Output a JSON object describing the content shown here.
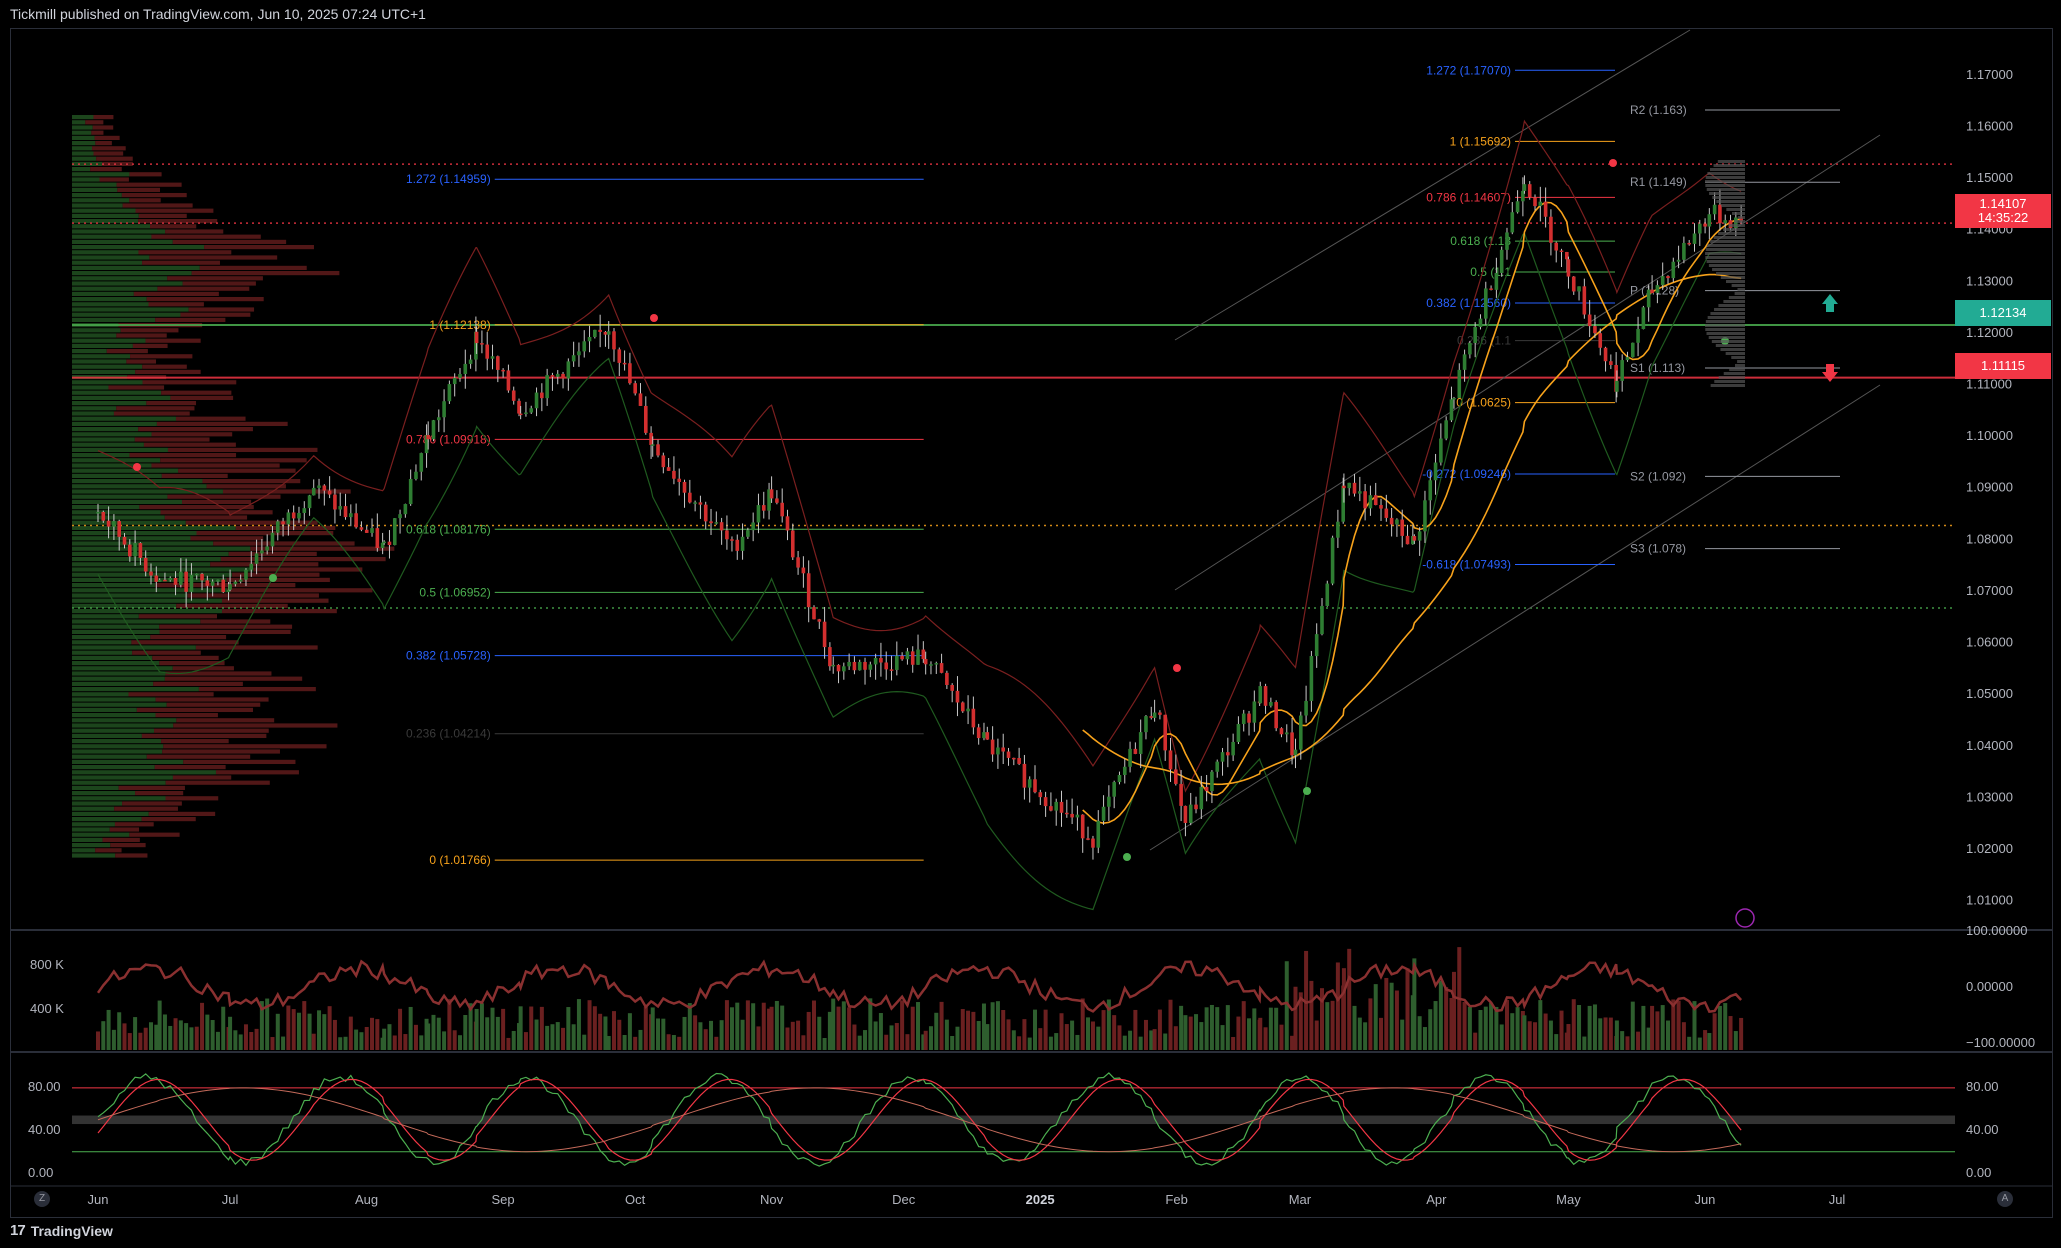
{
  "header": {
    "publisher": "Tickmill published on TradingView.com, Jun 10, 2025 07:24 UTC+1"
  },
  "footer": {
    "brand": "TradingView"
  },
  "badges": {
    "last_price": "1.14107",
    "countdown": "14:35:22",
    "green_level": "1.12134",
    "red_level": "1.11115"
  },
  "colors": {
    "up": "#22ab94",
    "candle_up": "#2e7d32",
    "candle_down": "#d32f2f",
    "red_line": "#f23645",
    "green_line": "#4caf50",
    "ma": "#f7a21b",
    "fib_blue": "#2962ff",
    "background": "#000000"
  },
  "chart_data": [
    {
      "type": "candlestick",
      "symbol_pair_unlabeled": true,
      "y_axis": {
        "ticks": [
          "1.17000",
          "1.16000",
          "1.15000",
          "1.14000",
          "1.13000",
          "1.12000",
          "1.11000",
          "1.10000",
          "1.09000",
          "1.08000",
          "1.07000",
          "1.06000",
          "1.05000",
          "1.04000",
          "1.03000",
          "1.02000",
          "1.01000"
        ],
        "range": [
          1.0045,
          1.1785
        ]
      },
      "x_axis": {
        "ticks": [
          "Jun",
          "Jul",
          "Aug",
          "Sep",
          "Oct",
          "Nov",
          "Dec",
          "2025",
          "Feb",
          "Mar",
          "Apr",
          "May",
          "Jun",
          "Jul"
        ]
      },
      "price_path": [
        [
          "2024-06-01",
          1.085
        ],
        [
          "2024-06-15",
          1.072
        ],
        [
          "2024-07-01",
          1.071
        ],
        [
          "2024-07-20",
          1.09
        ],
        [
          "2024-08-05",
          1.078
        ],
        [
          "2024-08-15",
          1.1
        ],
        [
          "2024-08-26",
          1.119
        ],
        [
          "2024-09-05",
          1.105
        ],
        [
          "2024-09-25",
          1.121
        ],
        [
          "2024-10-05",
          1.098
        ],
        [
          "2024-10-23",
          1.078
        ],
        [
          "2024-11-01",
          1.089
        ],
        [
          "2024-11-15",
          1.055
        ],
        [
          "2024-12-06",
          1.057
        ],
        [
          "2024-12-20",
          1.04
        ],
        [
          "2025-01-13",
          1.022
        ],
        [
          "2025-01-27",
          1.048
        ],
        [
          "2025-02-03",
          1.025
        ],
        [
          "2025-02-20",
          1.05
        ],
        [
          "2025-02-28",
          1.038
        ],
        [
          "2025-03-11",
          1.091
        ],
        [
          "2025-03-27",
          1.079
        ],
        [
          "2025-04-05",
          1.108
        ],
        [
          "2025-04-21",
          1.15
        ],
        [
          "2025-05-01",
          1.132
        ],
        [
          "2025-05-12",
          1.11
        ],
        [
          "2025-05-20",
          1.128
        ],
        [
          "2025-06-02",
          1.143
        ],
        [
          "2025-06-10",
          1.141
        ]
      ],
      "fib_left": [
        {
          "label": "1.272 (1.14959)",
          "value": 1.14959,
          "color": "#2962ff"
        },
        {
          "label": "1 (1.12138)",
          "value": 1.12138,
          "color": "#f7a21b"
        },
        {
          "label": "0.786 (1.09918)",
          "value": 1.09918,
          "color": "#f23645"
        },
        {
          "label": "0.618 (1.08176)",
          "value": 1.08176,
          "color": "#4caf50"
        },
        {
          "label": "0.5 (1.06952)",
          "value": 1.06952,
          "color": "#4caf50"
        },
        {
          "label": "0.382 (1.05728)",
          "value": 1.05728,
          "color": "#2962ff"
        },
        {
          "label": "0.236 (1.04214)",
          "value": 1.04214,
          "color": "#3a3a3a"
        },
        {
          "label": "0 (1.01766)",
          "value": 1.01766,
          "color": "#f7a21b"
        }
      ],
      "fib_right": [
        {
          "label": "1.272 (1.17070)",
          "value": 1.1707,
          "color": "#2962ff"
        },
        {
          "label": "1 (1.15692)",
          "value": 1.15692,
          "color": "#f7a21b"
        },
        {
          "label": "0.786 (1.14607)",
          "value": 1.14607,
          "color": "#f23645"
        },
        {
          "label": "0.618 (1.13",
          "value": 1.1376,
          "color": "#4caf50"
        },
        {
          "label": "0.5 (1.1",
          "value": 1.1316,
          "color": "#4caf50"
        },
        {
          "label": "0.382 (1.12560)",
          "value": 1.1256,
          "color": "#2962ff"
        },
        {
          "label": "0.236 (1.1",
          "value": 1.1183,
          "color": "#3a3a3a"
        },
        {
          "label": "0 (1.0625)",
          "value": 1.1063,
          "color": "#f7a21b"
        },
        {
          "label": "-0.272 (1.09246)",
          "value": 1.09246,
          "color": "#2962ff"
        },
        {
          "label": "-0.618 (1.07493)",
          "value": 1.07493,
          "color": "#2962ff"
        }
      ],
      "pivots": [
        {
          "label": "R2 (1.163)",
          "value": 1.163
        },
        {
          "label": "R1 (1.149)",
          "value": 1.149
        },
        {
          "label": "P (1.128)",
          "value": 1.128
        },
        {
          "label": "S1 (1.113)",
          "value": 1.113
        },
        {
          "label": "S2 (1.092)",
          "value": 1.092
        },
        {
          "label": "S3 (1.078)",
          "value": 1.078
        }
      ],
      "horizontal_levels": [
        {
          "value": 1.1525,
          "style": "dotted",
          "color": "#f23645"
        },
        {
          "value": 1.14107,
          "style": "dotted",
          "color": "#f23645"
        },
        {
          "value": 1.12134,
          "style": "solid",
          "color": "#4caf50"
        },
        {
          "value": 1.11115,
          "style": "solid",
          "color": "#f23645"
        },
        {
          "value": 1.0825,
          "style": "dotted",
          "color": "#f7a21b"
        },
        {
          "value": 1.0665,
          "style": "dotted",
          "color": "#4caf50"
        }
      ]
    },
    {
      "type": "histogram",
      "pane": "volume",
      "y_ticks_left": [
        "800 K",
        "400 K"
      ],
      "y_ticks_right": [
        "100.00000",
        "0.00000",
        "−100.00000"
      ]
    },
    {
      "type": "line",
      "pane": "oscillator",
      "y_ticks": [
        "80.00",
        "40.00",
        "0.00"
      ],
      "levels": [
        80,
        20
      ],
      "band": [
        46,
        54
      ]
    }
  ],
  "corners": {
    "left": "Z",
    "right": "A"
  }
}
